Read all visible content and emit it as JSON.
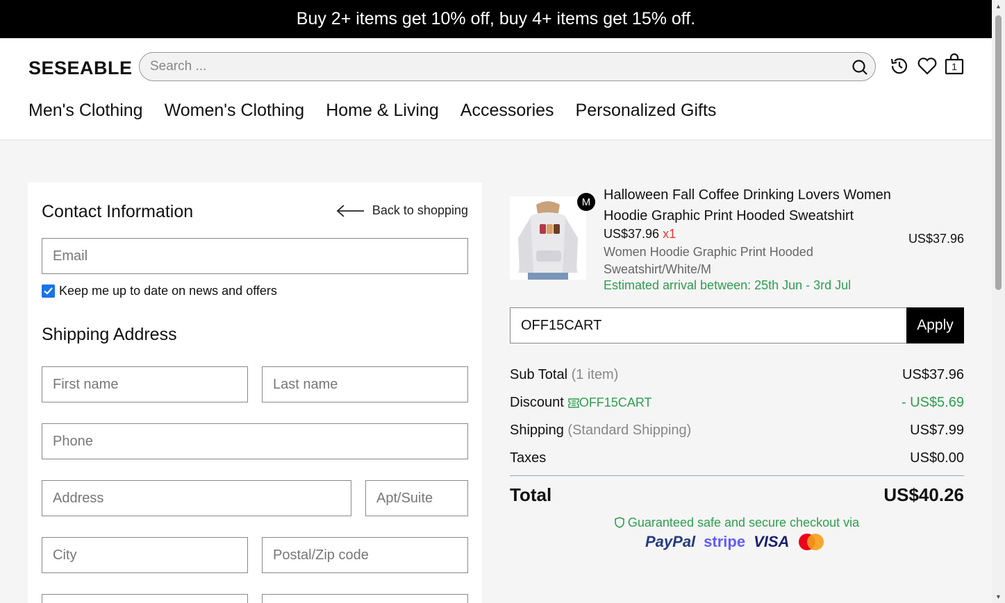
{
  "promo": {
    "text": "Buy 2+ items get 10% off, buy 4+ items get 15% off."
  },
  "header": {
    "logo": "SESEABLE",
    "search_placeholder": "Search ...",
    "cart_count": "1",
    "nav": [
      "Men's Clothing",
      "Women's Clothing",
      "Home & Living",
      "Accessories",
      "Personalized Gifts"
    ]
  },
  "contact": {
    "title": "Contact Information",
    "back_label": "Back to shopping",
    "email_placeholder": "Email",
    "newsletter_label": "Keep me up to date on news and offers",
    "newsletter_checked": true
  },
  "shipping": {
    "title": "Shipping Address",
    "first_name_placeholder": "First name",
    "last_name_placeholder": "Last name",
    "phone_placeholder": "Phone",
    "address_placeholder": "Address",
    "apt_placeholder": "Apt/Suite",
    "city_placeholder": "City",
    "zip_placeholder": "Postal/Zip code"
  },
  "order": {
    "item": {
      "badge": "M",
      "name": "Halloween Fall Coffee Drinking Lovers Women Hoodie Graphic Print Hooded Sweatshirt",
      "unit_price": "US$37.96",
      "qty": "x1",
      "variant": "Women Hoodie Graphic Print Hooded Sweatshirt/White/M",
      "eta": "Estimated arrival between: 25th Jun - 3rd Jul",
      "line_total": "US$37.96"
    },
    "coupon_value": "OFF15CART",
    "apply_label": "Apply",
    "subtotal_label": "Sub Total",
    "subtotal_note": "(1 item)",
    "subtotal_value": "US$37.96",
    "discount_label": "Discount",
    "discount_code": "OFF15CART",
    "discount_value": "- US$5.69",
    "shipping_label": "Shipping",
    "shipping_note": "(Standard Shipping)",
    "shipping_value": "US$7.99",
    "taxes_label": "Taxes",
    "taxes_value": "US$0.00",
    "total_label": "Total",
    "total_value": "US$40.26",
    "secure_text": "Guaranteed safe and secure checkout via",
    "payment_methods": [
      "PayPal",
      "stripe",
      "VISA"
    ]
  },
  "colors": {
    "accent_green": "#2e9e4f",
    "checkbox_blue": "#1a73e8",
    "qty_red": "#e53935"
  }
}
